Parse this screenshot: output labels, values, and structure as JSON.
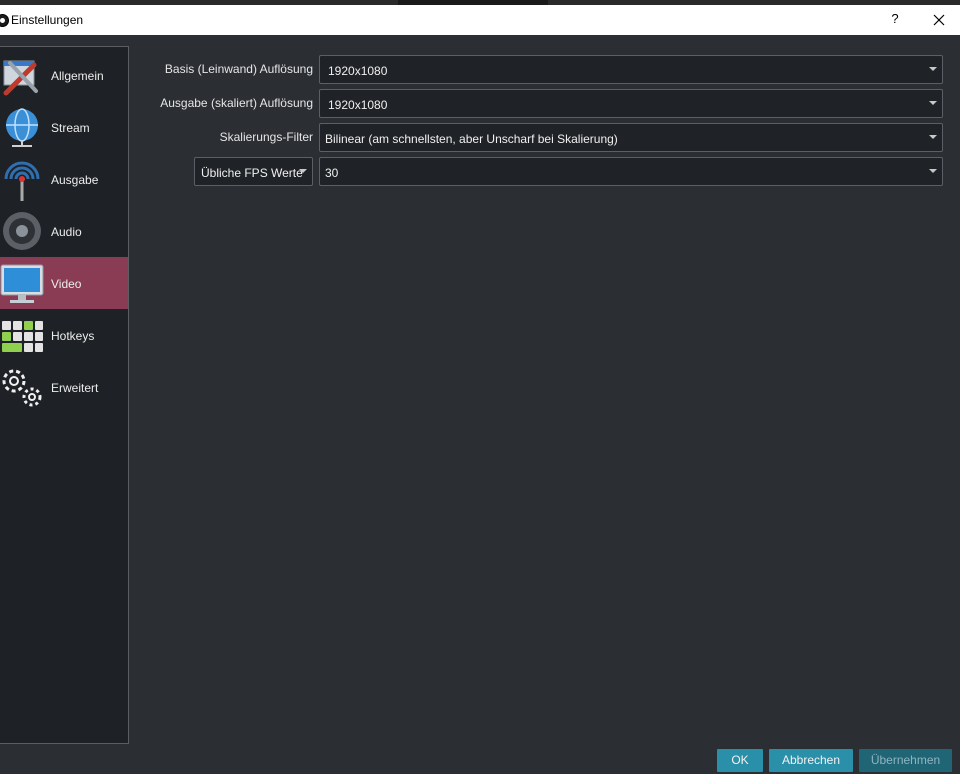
{
  "window": {
    "title": "Einstellungen",
    "help_label": "?"
  },
  "sidebar": {
    "items": [
      {
        "label": "Allgemein",
        "icon": "wrench-screwdriver-icon",
        "active": false
      },
      {
        "label": "Stream",
        "icon": "globe-network-icon",
        "active": false
      },
      {
        "label": "Ausgabe",
        "icon": "broadcast-antenna-icon",
        "active": false
      },
      {
        "label": "Audio",
        "icon": "speaker-icon",
        "active": false
      },
      {
        "label": "Video",
        "icon": "monitor-icon",
        "active": true
      },
      {
        "label": "Hotkeys",
        "icon": "keyboard-icon",
        "active": false
      },
      {
        "label": "Erweitert",
        "icon": "gears-icon",
        "active": false
      }
    ]
  },
  "video": {
    "base_resolution": {
      "label": "Basis (Leinwand) Auflösung",
      "value": "1920x1080"
    },
    "output_resolution": {
      "label": "Ausgabe (skaliert) Auflösung",
      "value": "1920x1080"
    },
    "downscale_filter": {
      "label": "Skalierungs-Filter",
      "value": "Bilinear (am schnellsten, aber Unscharf bei Skalierung)"
    },
    "fps": {
      "type_value": "Übliche FPS Werte",
      "value": "30"
    }
  },
  "buttons": {
    "ok": "OK",
    "cancel": "Abbrechen",
    "apply": "Übernehmen"
  },
  "colors": {
    "accent": "#2a8fa8",
    "active_nav": "#8a3c55"
  }
}
